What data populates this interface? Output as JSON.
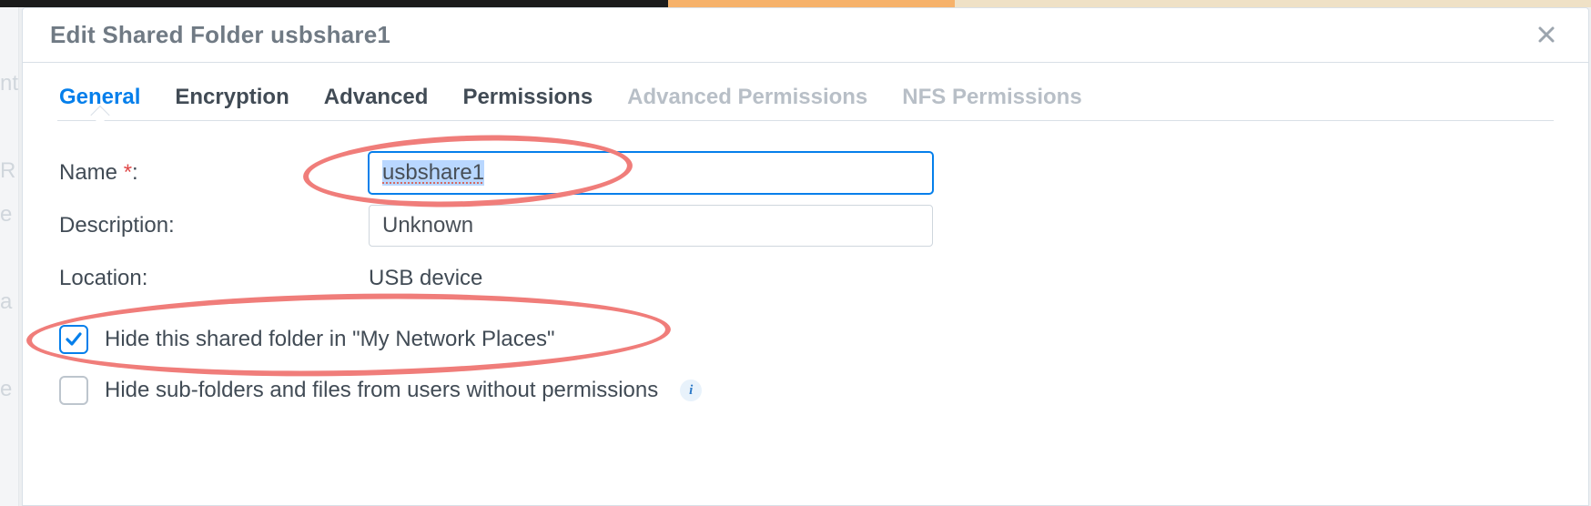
{
  "header": {
    "title": "Edit Shared Folder usbshare1"
  },
  "tabs": [
    {
      "key": "general",
      "label": "General",
      "active": true,
      "disabled": false
    },
    {
      "key": "encryption",
      "label": "Encryption",
      "active": false,
      "disabled": false
    },
    {
      "key": "advanced",
      "label": "Advanced",
      "active": false,
      "disabled": false
    },
    {
      "key": "permissions",
      "label": "Permissions",
      "active": false,
      "disabled": false
    },
    {
      "key": "adv-permissions",
      "label": "Advanced Permissions",
      "active": false,
      "disabled": true
    },
    {
      "key": "nfs-permissions",
      "label": "NFS Permissions",
      "active": false,
      "disabled": true
    }
  ],
  "form": {
    "name_label": "Name",
    "name_value": "usbshare1",
    "description_label": "Description:",
    "description_value": "Unknown",
    "location_label": "Location:",
    "location_value": "USB device",
    "hide_network_label": "Hide this shared folder in \"My Network Places\"",
    "hide_network_checked": true,
    "hide_subfolders_label": "Hide sub-folders and files from users without permissions",
    "hide_subfolders_checked": false
  }
}
